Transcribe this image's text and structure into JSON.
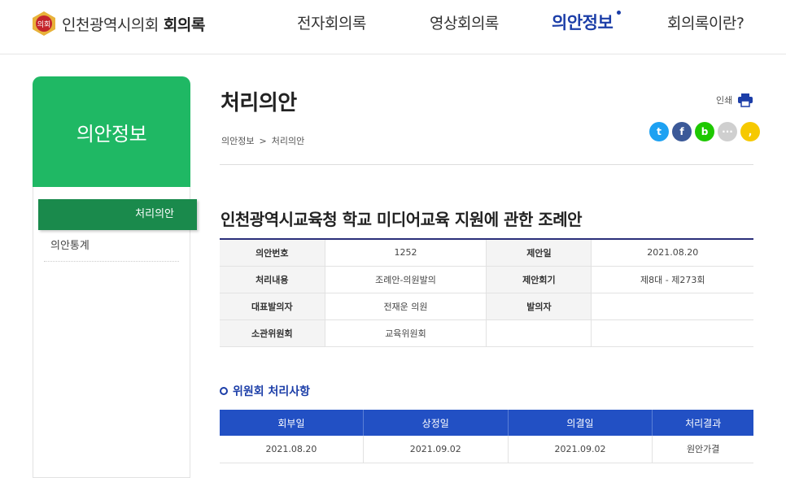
{
  "header": {
    "site_name": "인천광역시의회",
    "site_name_bold": "회의록",
    "emblem_text": "의회",
    "nav": [
      {
        "label": "전자회의록",
        "active": false
      },
      {
        "label": "영상회의록",
        "active": false
      },
      {
        "label": "의안정보",
        "active": true
      },
      {
        "label": "회의록이란?",
        "active": false
      }
    ]
  },
  "sidebar": {
    "title": "의안정보",
    "items": [
      {
        "label": "처리의안",
        "active": true
      },
      {
        "label": "의안통계",
        "active": false
      }
    ]
  },
  "main": {
    "page_title": "처리의안",
    "breadcrumb": [
      "의안정보",
      "처리의안"
    ],
    "breadcrumb_sep": ">",
    "print_label": "인쇄",
    "sns": [
      {
        "icon": "twitter-icon",
        "glyph": "t",
        "color": "#1da1f2"
      },
      {
        "icon": "facebook-icon",
        "glyph": "f",
        "color": "#3b5998"
      },
      {
        "icon": "band-icon",
        "glyph": "b",
        "color": "#1ec800"
      },
      {
        "icon": "talk-icon",
        "glyph": "···",
        "color": "#cfcfcf"
      },
      {
        "icon": "kakaostory-icon",
        "glyph": ",",
        "color": "#f6c900"
      }
    ],
    "bill_title": "인천광역시교육청 학교 미디어교육 지원에 관한 조례안",
    "info": {
      "bill_no_label": "의안번호",
      "bill_no": "1252",
      "proposed_date_label": "제안일",
      "proposed_date": "2021.08.20",
      "content_label": "처리내용",
      "content": "조례안-의원발의",
      "session_label": "제안회기",
      "session": "제8대 - 제273회",
      "rep_label": "대표발의자",
      "rep": "전재운 의원",
      "proposer_label": "발의자",
      "proposer": "",
      "committee_label": "소관위원회",
      "committee": "교육위원회"
    },
    "committee_section": {
      "title": "위원회 처리사항",
      "headers": [
        "회부일",
        "상정일",
        "의결일",
        "처리결과"
      ],
      "rows": [
        [
          "2021.08.20",
          "2021.09.02",
          "2021.09.02",
          "원안가결"
        ]
      ]
    }
  }
}
